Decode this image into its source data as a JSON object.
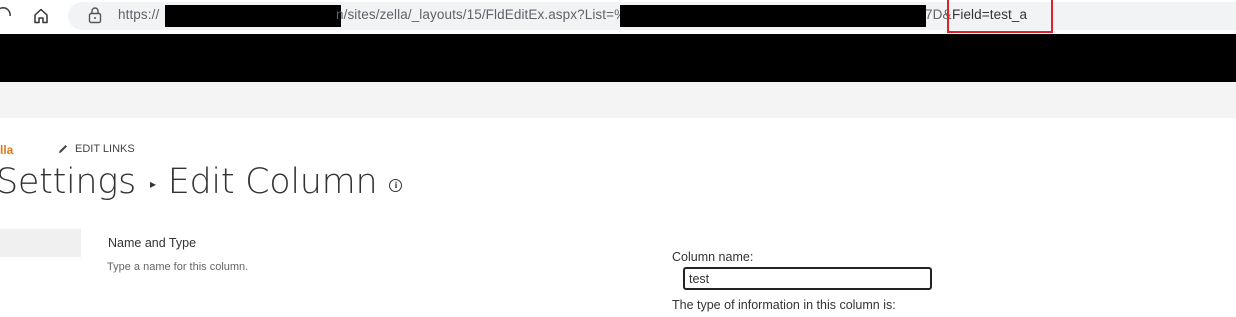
{
  "browser": {
    "url_prefix": "https://",
    "url_middle": "n/sites/zella/_layouts/15/FldEditEx.aspx?List=%",
    "url_tail_visible": "7D&",
    "url_field_param": "Field=test_a",
    "home_icon": "home-icon",
    "lock_icon": "lock-icon",
    "highlight_color": "#e0202b"
  },
  "site": {
    "breadcrumb_link": "lla",
    "edit_links_label": "EDIT LINKS"
  },
  "page": {
    "title_part1": "Settings",
    "title_separator": "▸",
    "title_part2": "Edit Column",
    "info_glyph": "i"
  },
  "section": {
    "title": "Name and Type",
    "description": "Type a name for this column."
  },
  "form": {
    "column_name_label": "Column name:",
    "column_name_value": "test",
    "type_label": "The type of information in this column is:"
  },
  "colors": {
    "accent_orange": "#e07b1c",
    "suitebar": "#000000"
  }
}
